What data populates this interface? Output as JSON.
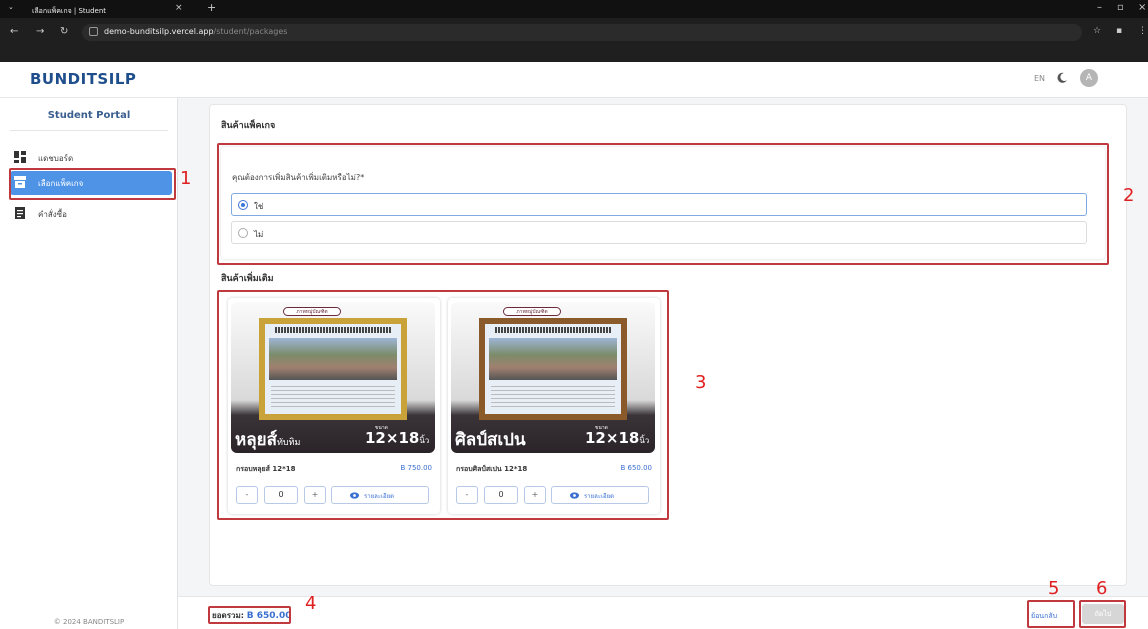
{
  "browser": {
    "tab_title": "เลือกแพ็คเกจ | Student",
    "url_host": "demo-bunditsilp.vercel.app",
    "url_path": "/student/packages"
  },
  "header": {
    "logo": "BUNDITSILP",
    "lang": "EN",
    "avatar_initial": "A"
  },
  "sidebar": {
    "portal_title": "Student Portal",
    "items": [
      {
        "label": "แดชบอร์ด",
        "icon": "dashboard-icon"
      },
      {
        "label": "เลือกแพ็คเกจ",
        "icon": "package-icon"
      },
      {
        "label": "คำสั่งซื้อ",
        "icon": "order-icon"
      }
    ],
    "copyright": "© 2024 BANDITSLIP"
  },
  "main": {
    "page_title": "สินค้าแพ็คเกจ",
    "question": "คุณต้องการเพิ่มสินค้าเพิ่มเติมหรือไม่?*",
    "options": [
      "ใช่",
      "ไม่"
    ],
    "addons_title": "สินค้าเพิ่มเติม",
    "products": [
      {
        "badge": "ภาพหมู่บัณฑิต",
        "img_name": "หลุยส์",
        "img_name_small": "ทับทิม",
        "size_label": "ขนาด",
        "size": "12×18",
        "size_unit": "นิ้ว",
        "name": "กรอบหลุยส์ 12*18",
        "price": "B 750.00",
        "qty": "0",
        "detail_label": "รายละเอียด"
      },
      {
        "badge": "ภาพหมู่บัณฑิต",
        "img_name": "ศิลป์สเปน",
        "img_name_small": "",
        "size_label": "ขนาด",
        "size": "12×18",
        "size_unit": "นิ้ว",
        "name": "กรอบศิลป์สเปน 12*18",
        "price": "B 650.00",
        "qty": "0",
        "detail_label": "รายละเอียด"
      }
    ],
    "stepper_minus": "-",
    "stepper_plus": "+"
  },
  "footer": {
    "total_label": "ยอดรวม:",
    "total_amount": "B 650.00",
    "back_label": "ย้อนกลับ",
    "next_label": "ถัดไป"
  },
  "annotations": [
    "1",
    "2",
    "3",
    "4",
    "5",
    "6"
  ],
  "colors": {
    "accent": "#4f93e6",
    "annotation": "#c0393f",
    "price": "#3b6fd1"
  }
}
